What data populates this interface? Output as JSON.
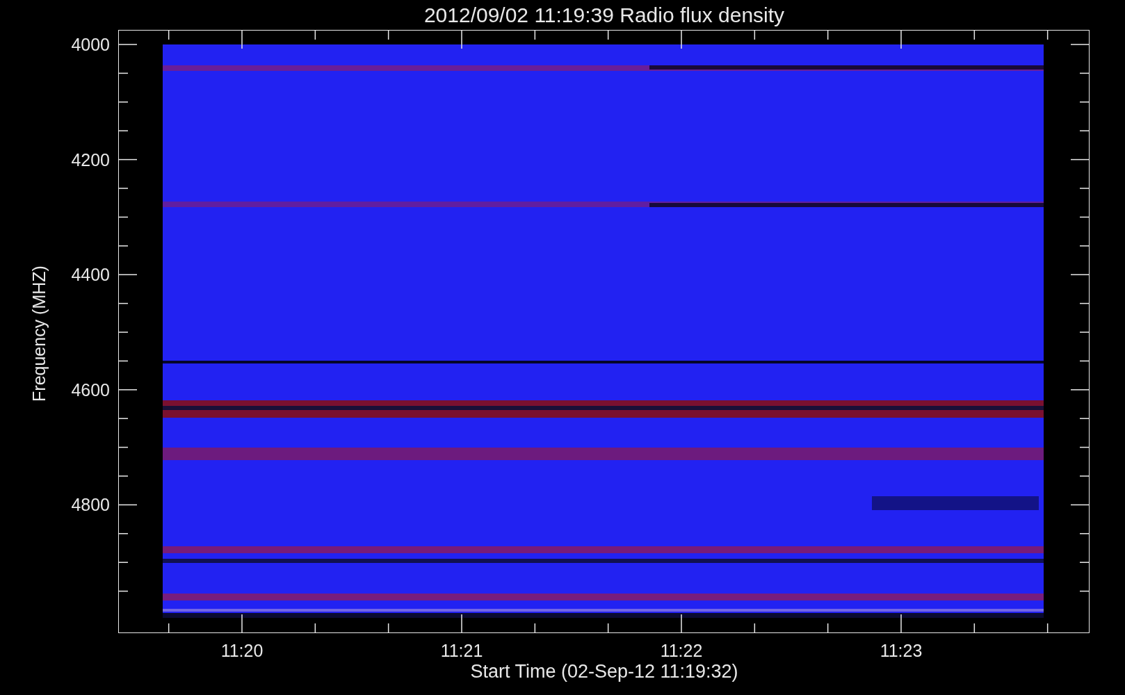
{
  "title": "2012/09/02 11:19:39 Radio flux density",
  "ylabel": "Frequency (MHZ)",
  "xlabel": "Start Time (02-Sep-12 11:19:32)",
  "yticks": [
    "4000",
    "4200",
    "4400",
    "4600",
    "4800"
  ],
  "xticks": [
    "11:20",
    "11:21",
    "11:22",
    "11:23"
  ]
}
